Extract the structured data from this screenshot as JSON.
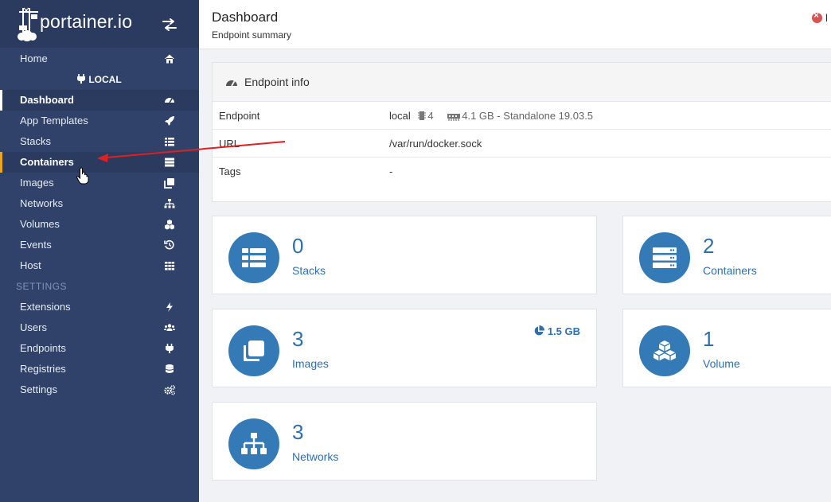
{
  "brand": {
    "name": "portainer.io"
  },
  "sidebar": {
    "home": "Home",
    "endpoint": "LOCAL",
    "items": [
      {
        "label": "Dashboard",
        "icon": "tachometer-icon"
      },
      {
        "label": "App Templates",
        "icon": "rocket-icon"
      },
      {
        "label": "Stacks",
        "icon": "th-list-icon"
      },
      {
        "label": "Containers",
        "icon": "server-icon"
      },
      {
        "label": "Images",
        "icon": "clone-icon"
      },
      {
        "label": "Networks",
        "icon": "sitemap-icon"
      },
      {
        "label": "Volumes",
        "icon": "cubes-icon"
      },
      {
        "label": "Events",
        "icon": "history-icon"
      },
      {
        "label": "Host",
        "icon": "th-icon"
      }
    ],
    "settings_section": "SETTINGS",
    "settings_items": [
      {
        "label": "Extensions",
        "icon": "bolt-icon"
      },
      {
        "label": "Users",
        "icon": "users-icon"
      },
      {
        "label": "Endpoints",
        "icon": "plug-icon"
      },
      {
        "label": "Registries",
        "icon": "database-icon"
      },
      {
        "label": "Settings",
        "icon": "cogs-icon"
      }
    ]
  },
  "header": {
    "title": "Dashboard",
    "subtitle": "Endpoint summary",
    "status_text": "l"
  },
  "endpoint_info": {
    "title": "Endpoint info",
    "rows": [
      {
        "key": "Endpoint",
        "name": "local",
        "cpu": "4",
        "memory": "4.1 GB",
        "mode": "- Standalone 19.03.5"
      },
      {
        "key": "URL",
        "value": "/var/run/docker.sock"
      },
      {
        "key": "Tags",
        "value": "-"
      }
    ]
  },
  "tiles": {
    "stacks": {
      "count": "0",
      "label": "Stacks"
    },
    "containers": {
      "count": "2",
      "label": "Containers"
    },
    "images": {
      "count": "3",
      "label": "Images",
      "size": "1.5 GB"
    },
    "volumes": {
      "count": "1",
      "label": "Volume"
    },
    "networks": {
      "count": "3",
      "label": "Networks"
    }
  },
  "colors": {
    "sidebar": "#30426a",
    "brand_bg": "#2a3b5f",
    "accent": "#337ab7",
    "hover_border": "#f0a520",
    "annotation_arrow": "#e02020"
  }
}
